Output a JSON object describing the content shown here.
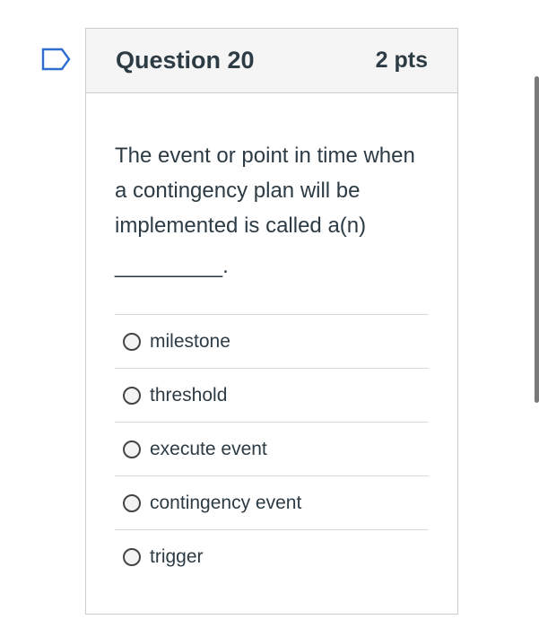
{
  "question": {
    "title": "Question 20",
    "points": "2 pts",
    "text": "The event or point in time when a contingency plan will be implemented is called a(n)",
    "blank": "_________."
  },
  "answers": [
    {
      "label": "milestone",
      "selected": false
    },
    {
      "label": "threshold",
      "selected": false
    },
    {
      "label": "execute event",
      "selected": false
    },
    {
      "label": "contingency event",
      "selected": false
    },
    {
      "label": "trigger",
      "selected": false
    }
  ],
  "icons": {
    "flag": "bookmark-flag-icon"
  },
  "colors": {
    "flag": "#2d6ed0",
    "header_bg": "#f5f5f5",
    "text": "#2d3b45",
    "border": "#c7cdd1"
  }
}
